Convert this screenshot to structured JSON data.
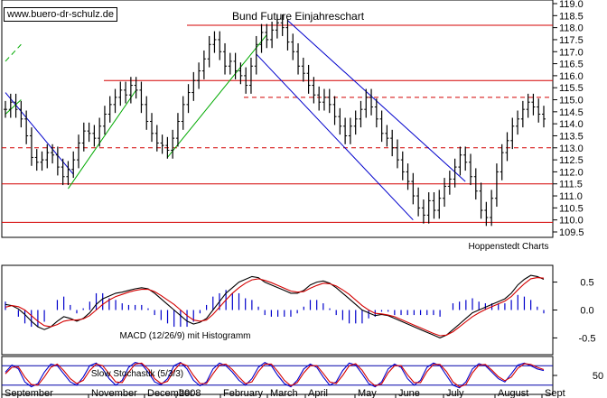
{
  "watermark": "www.buero-dr-schulz.de",
  "chart_data": [
    {
      "type": "candlestick",
      "title": "Bund Future Einjahreschart",
      "source_note": "Hoppenstedt Charts",
      "y_ticks": [
        "119.0",
        "118.5",
        "118.0",
        "117.5",
        "117.0",
        "116.5",
        "116.0",
        "115.5",
        "115.0",
        "114.5",
        "114.0",
        "113.5",
        "113.0",
        "112.5",
        "112.0",
        "111.5",
        "111.0",
        "110.5",
        "110.0",
        "109.5"
      ],
      "ylim": [
        109.5,
        119.0
      ],
      "x_labels": [
        "September",
        "November",
        "December",
        "2008",
        "February",
        "March",
        "April",
        "May",
        "June",
        "July",
        "August",
        "Sept"
      ],
      "horizontal_levels": [
        {
          "value": 118.1,
          "style": "solid"
        },
        {
          "value": 115.8,
          "style": "solid"
        },
        {
          "value": 115.1,
          "style": "dashed"
        },
        {
          "value": 113.0,
          "style": "dashed"
        },
        {
          "value": 111.5,
          "style": "solid"
        },
        {
          "value": 109.9,
          "style": "solid"
        }
      ],
      "closes": [
        114.6,
        114.9,
        114.6,
        114.2,
        113.5,
        112.6,
        112.4,
        112.5,
        112.8,
        112.7,
        112.2,
        111.8,
        112.1,
        112.5,
        113.2,
        113.7,
        113.6,
        113.4,
        113.9,
        114.4,
        114.8,
        115.1,
        115.4,
        115.2,
        115.6,
        115.4,
        114.8,
        114.1,
        113.6,
        113.2,
        113.1,
        112.9,
        113.4,
        114.1,
        114.8,
        115.3,
        115.8,
        116.2,
        116.7,
        117.3,
        117.5,
        117.0,
        116.4,
        116.6,
        116.2,
        116.0,
        115.6,
        116.4,
        117.3,
        117.8,
        117.5,
        117.9,
        118.2,
        118.0,
        117.4,
        117.0,
        116.4,
        116.1,
        115.6,
        115.2,
        114.9,
        115.1,
        114.8,
        114.3,
        113.9,
        113.5,
        113.9,
        114.2,
        114.6,
        115.1,
        114.7,
        114.2,
        113.6,
        113.4,
        113.0,
        112.5,
        112.0,
        111.6,
        111.0,
        110.5,
        110.2,
        110.8,
        110.4,
        110.9,
        111.4,
        111.7,
        112.2,
        112.7,
        112.4,
        111.8,
        111.2,
        110.4,
        110.1,
        110.9,
        112.0,
        112.8,
        113.3,
        113.9,
        114.2,
        114.6,
        114.9,
        114.7,
        114.4,
        114.2
      ]
    },
    {
      "type": "line",
      "label": "MACD (12/26/9) mit Histogramm",
      "y_ticks": [
        "0.5",
        "0.0",
        "-0.5"
      ],
      "ylim": [
        -0.8,
        0.8
      ],
      "series": [
        {
          "color": "#000000",
          "values": [
            0.1,
            0.08,
            0.02,
            -0.08,
            -0.2,
            -0.3,
            -0.35,
            -0.3,
            -0.2,
            -0.12,
            -0.15,
            -0.2,
            -0.15,
            -0.05,
            0.1,
            0.2,
            0.25,
            0.3,
            0.32,
            0.35,
            0.38,
            0.4,
            0.38,
            0.3,
            0.2,
            0.1,
            0.0,
            -0.1,
            -0.2,
            -0.25,
            -0.22,
            -0.15,
            0.0,
            0.15,
            0.3,
            0.4,
            0.5,
            0.55,
            0.6,
            0.58,
            0.5,
            0.45,
            0.4,
            0.35,
            0.3,
            0.3,
            0.35,
            0.45,
            0.5,
            0.52,
            0.48,
            0.4,
            0.3,
            0.2,
            0.1,
            0.0,
            -0.05,
            -0.1,
            -0.08,
            -0.1,
            -0.15,
            -0.2,
            -0.25,
            -0.3,
            -0.35,
            -0.4,
            -0.45,
            -0.5,
            -0.45,
            -0.35,
            -0.25,
            -0.15,
            -0.05,
            0.0,
            0.05,
            0.1,
            0.15,
            0.2,
            0.3,
            0.45,
            0.55,
            0.62,
            0.6,
            0.55
          ]
        },
        {
          "color": "#d40000",
          "values": [
            0.05,
            0.08,
            0.06,
            0.0,
            -0.1,
            -0.2,
            -0.28,
            -0.3,
            -0.26,
            -0.2,
            -0.18,
            -0.18,
            -0.16,
            -0.1,
            0.0,
            0.1,
            0.18,
            0.24,
            0.28,
            0.32,
            0.35,
            0.37,
            0.37,
            0.33,
            0.26,
            0.18,
            0.1,
            0.0,
            -0.1,
            -0.18,
            -0.2,
            -0.18,
            -0.08,
            0.05,
            0.18,
            0.3,
            0.4,
            0.48,
            0.54,
            0.56,
            0.53,
            0.49,
            0.44,
            0.39,
            0.34,
            0.32,
            0.33,
            0.39,
            0.44,
            0.48,
            0.47,
            0.43,
            0.36,
            0.28,
            0.18,
            0.08,
            0.0,
            -0.06,
            -0.07,
            -0.09,
            -0.12,
            -0.17,
            -0.22,
            -0.27,
            -0.32,
            -0.37,
            -0.42,
            -0.46,
            -0.45,
            -0.39,
            -0.3,
            -0.21,
            -0.12,
            -0.05,
            0.01,
            0.06,
            0.11,
            0.16,
            0.24,
            0.36,
            0.47,
            0.56,
            0.58,
            0.57
          ]
        }
      ]
    },
    {
      "type": "line",
      "label": "Slow Stochastik (5/3/3)",
      "y_ticks": [
        "50"
      ],
      "ylim": [
        0,
        100
      ],
      "levels": [
        80,
        20
      ],
      "series": [
        {
          "color": "#0000cc",
          "values": [
            60,
            82,
            70,
            30,
            15,
            25,
            60,
            85,
            80,
            55,
            30,
            20,
            45,
            80,
            88,
            70,
            40,
            20,
            35,
            75,
            90,
            85,
            60,
            30,
            22,
            40,
            80,
            90,
            70,
            35,
            18,
            30,
            70,
            88,
            80,
            60,
            35,
            20,
            40,
            75,
            90,
            80,
            50,
            25,
            15,
            35,
            70,
            85,
            75,
            45,
            20,
            30,
            65,
            88,
            82,
            55,
            25,
            15,
            30,
            70,
            85,
            75,
            40,
            20,
            35,
            75,
            88,
            80,
            50,
            20,
            12,
            30,
            70,
            86,
            80,
            60,
            40,
            30,
            55,
            82,
            88,
            80,
            70,
            65
          ]
        },
        {
          "color": "#d40000",
          "values": [
            55,
            75,
            76,
            45,
            22,
            20,
            45,
            75,
            85,
            65,
            40,
            25,
            35,
            65,
            85,
            80,
            55,
            30,
            28,
            60,
            85,
            88,
            70,
            40,
            25,
            32,
            65,
            88,
            80,
            50,
            25,
            25,
            55,
            82,
            85,
            68,
            45,
            25,
            30,
            62,
            85,
            85,
            62,
            35,
            18,
            28,
            58,
            80,
            80,
            56,
            30,
            25,
            50,
            80,
            86,
            66,
            35,
            18,
            24,
            58,
            80,
            80,
            52,
            28,
            28,
            62,
            84,
            84,
            62,
            30,
            15,
            22,
            58,
            82,
            84,
            66,
            46,
            34,
            45,
            72,
            86,
            84,
            75,
            68
          ]
        }
      ]
    }
  ]
}
